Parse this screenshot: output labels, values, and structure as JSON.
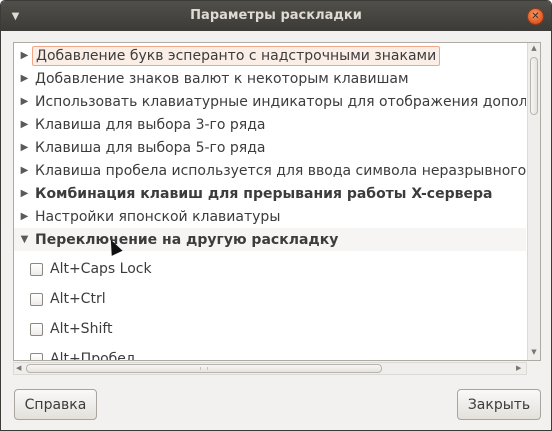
{
  "window": {
    "title": "Параметры раскладки"
  },
  "tree": {
    "items": [
      {
        "label": "Добавление букв эсперанто с надстрочными знаками",
        "expanded": false,
        "bold": false,
        "selected": true
      },
      {
        "label": "Добавление знаков валют к некоторым клавишам",
        "expanded": false,
        "bold": false
      },
      {
        "label": "Использовать клавиатурные индикаторы для отображения дополнительных раскладок",
        "expanded": false,
        "bold": false
      },
      {
        "label": "Клавиша для выбора 3-го ряда",
        "expanded": false,
        "bold": false
      },
      {
        "label": "Клавиша для выбора 5-го ряда",
        "expanded": false,
        "bold": false
      },
      {
        "label": "Клавиша пробела используется для ввода символа неразрывного пробела",
        "expanded": false,
        "bold": false
      },
      {
        "label": "Комбинация клавиш для прерывания работы X-сервера",
        "expanded": false,
        "bold": true
      },
      {
        "label": "Настройки японской клавиатуры",
        "expanded": false,
        "bold": false
      },
      {
        "label": "Переключение на другую раскладку",
        "expanded": true,
        "bold": true
      }
    ],
    "options": [
      {
        "label": "Alt+Caps Lock",
        "checked": false
      },
      {
        "label": "Alt+Ctrl",
        "checked": false
      },
      {
        "label": "Alt+Shift",
        "checked": false
      },
      {
        "label": "Alt+Пробел",
        "checked": false
      }
    ],
    "icons": {
      "collapsed": "triangle-right-icon",
      "expanded": "triangle-down-icon"
    }
  },
  "buttons": {
    "help": "Справка",
    "close": "Закрыть"
  },
  "colors": {
    "titlebar": "#3c3b37",
    "close_button": "#e0561f",
    "selection_border": "#f0a789"
  }
}
